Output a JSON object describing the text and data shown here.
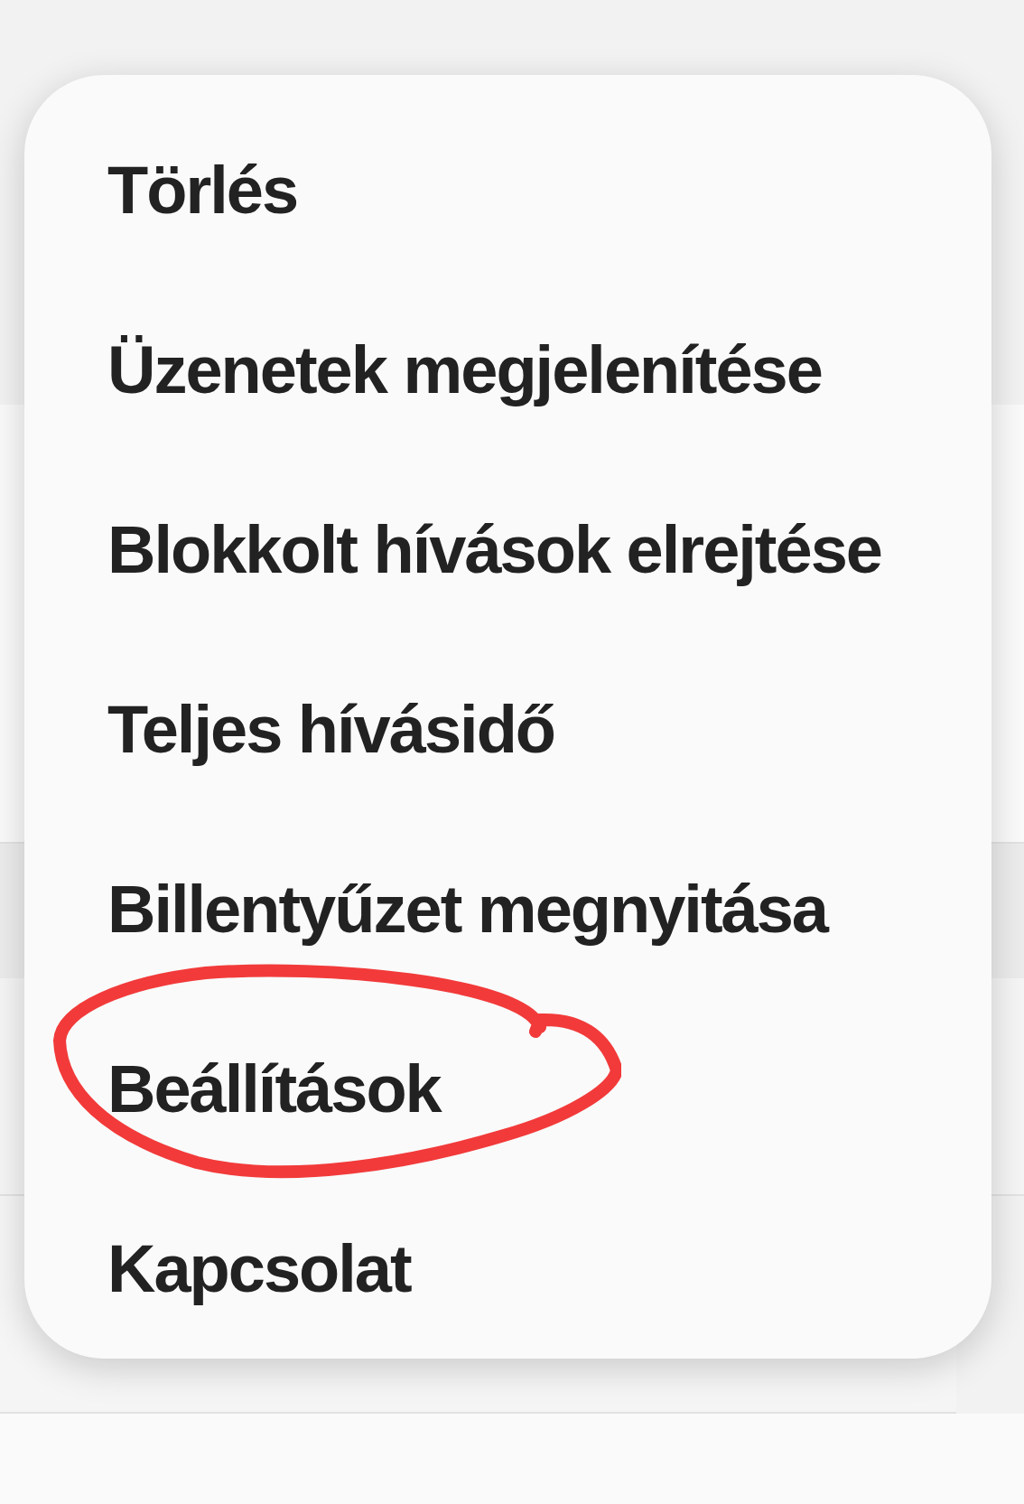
{
  "menu": {
    "items": [
      {
        "label": "Törlés"
      },
      {
        "label": "Üzenetek megjelenítése"
      },
      {
        "label": "Blokkolt hívások elrejtése"
      },
      {
        "label": "Teljes hívásidő"
      },
      {
        "label": "Billentyűzet megnyitása"
      },
      {
        "label": "Beállítások"
      },
      {
        "label": "Kapcsolat"
      }
    ]
  }
}
